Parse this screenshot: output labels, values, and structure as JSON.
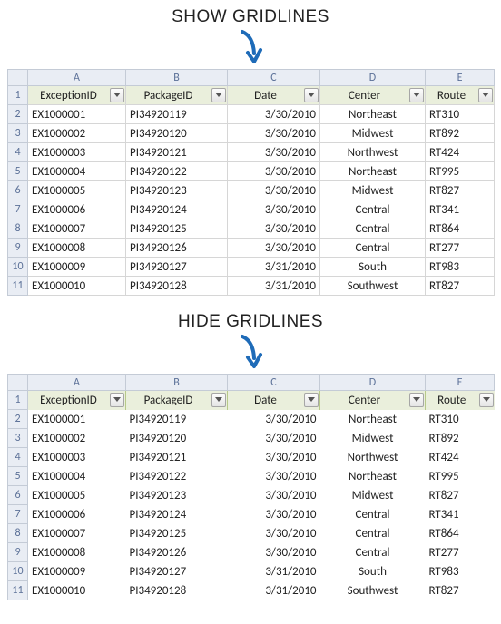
{
  "labels": {
    "show": "SHOW GRIDLINES",
    "hide": "HIDE GRIDLINES"
  },
  "columns": [
    "A",
    "B",
    "C",
    "D",
    "E"
  ],
  "rowNumbers": [
    1,
    2,
    3,
    4,
    5,
    6,
    7,
    8,
    9,
    10,
    11
  ],
  "headers": {
    "exceptionId": "ExceptionID",
    "packageId": "PackageID",
    "date": "Date",
    "center": "Center",
    "route": "Route"
  },
  "rows": [
    {
      "exceptionId": "EX1000001",
      "packageId": "PI34920119",
      "date": "3/30/2010",
      "center": "Northeast",
      "route": "RT310"
    },
    {
      "exceptionId": "EX1000002",
      "packageId": "PI34920120",
      "date": "3/30/2010",
      "center": "Midwest",
      "route": "RT892"
    },
    {
      "exceptionId": "EX1000003",
      "packageId": "PI34920121",
      "date": "3/30/2010",
      "center": "Northwest",
      "route": "RT424"
    },
    {
      "exceptionId": "EX1000004",
      "packageId": "PI34920122",
      "date": "3/30/2010",
      "center": "Northeast",
      "route": "RT995"
    },
    {
      "exceptionId": "EX1000005",
      "packageId": "PI34920123",
      "date": "3/30/2010",
      "center": "Midwest",
      "route": "RT827"
    },
    {
      "exceptionId": "EX1000006",
      "packageId": "PI34920124",
      "date": "3/30/2010",
      "center": "Central",
      "route": "RT341"
    },
    {
      "exceptionId": "EX1000007",
      "packageId": "PI34920125",
      "date": "3/30/2010",
      "center": "Central",
      "route": "RT864"
    },
    {
      "exceptionId": "EX1000008",
      "packageId": "PI34920126",
      "date": "3/30/2010",
      "center": "Central",
      "route": "RT277"
    },
    {
      "exceptionId": "EX1000009",
      "packageId": "PI34920127",
      "date": "3/31/2010",
      "center": "South",
      "route": "RT983"
    },
    {
      "exceptionId": "EX1000010",
      "packageId": "PI34920128",
      "date": "3/31/2010",
      "center": "Southwest",
      "route": "RT827"
    }
  ]
}
